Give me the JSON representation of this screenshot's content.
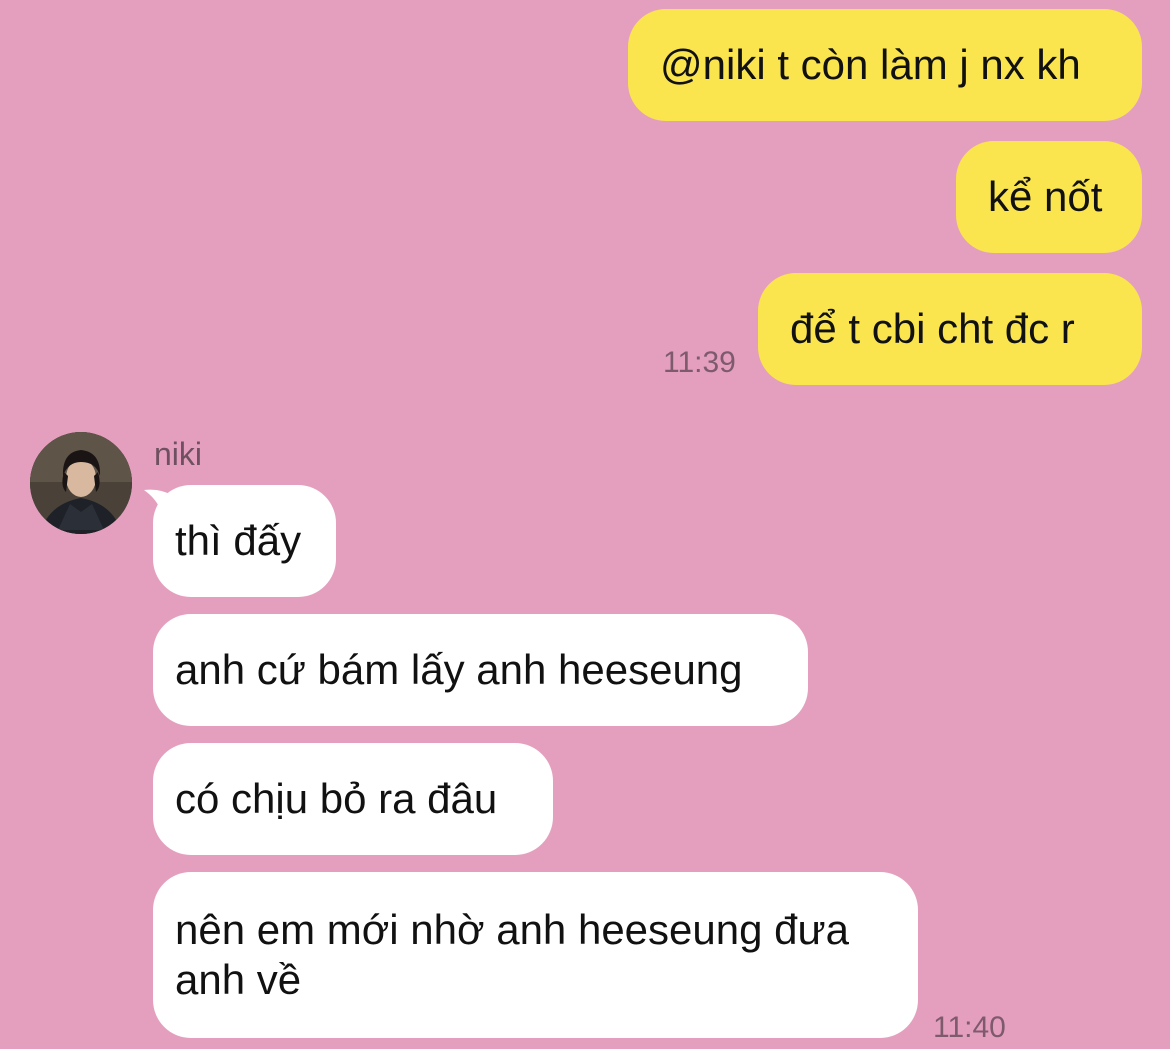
{
  "sent": [
    {
      "text": "@niki t còn làm j nx kh"
    },
    {
      "text": "kể nốt"
    },
    {
      "text": "để t cbi cht đc r"
    }
  ],
  "sent_time": "11:39",
  "contact": {
    "name": "niki",
    "avatar_icon": "user-avatar-photo"
  },
  "received": [
    {
      "text": "thì đấy"
    },
    {
      "text": "anh cứ bám lấy anh heeseung"
    },
    {
      "text": "có chịu bỏ ra đâu"
    },
    {
      "line1": "nên em mới nhờ anh heeseung đưa",
      "line2": "anh về"
    }
  ],
  "received_time": "11:40",
  "colors": {
    "background": "#e49fbf",
    "sent_bubble": "#fae54f",
    "received_bubble": "#ffffff"
  }
}
